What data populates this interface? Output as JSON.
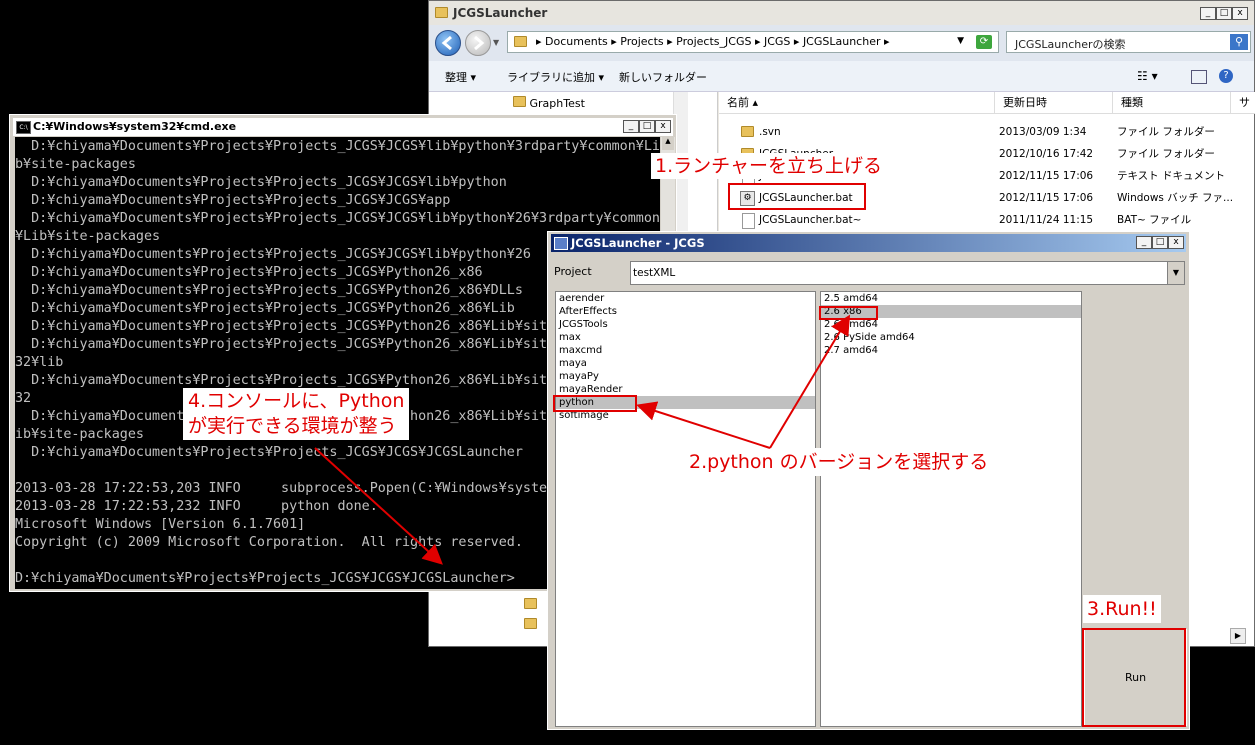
{
  "explorer": {
    "title": "JCGSLauncher",
    "breadcrumb": [
      "Documents",
      "Projects",
      "Projects_JCGS",
      "JCGS",
      "JCGSLauncher"
    ],
    "search_placeholder": "JCGSLauncherの検索",
    "toolbar": {
      "organize": "整理",
      "add_to_library": "ライブラリに追加",
      "new_folder": "新しいフォルダー"
    },
    "nav_item": "GraphTest",
    "columns": {
      "name": "名前",
      "modified": "更新日時",
      "type": "種類",
      "size": "サ"
    },
    "files": [
      {
        "name": ".svn",
        "modified": "2013/03/09 1:34",
        "type": "ファイル フォルダー"
      },
      {
        "name": "JCGSLauncher",
        "modified": "2012/10/16 17:42",
        "type": "ファイル フォルダー"
      },
      {
        "name": "JCGSLauncher.txt",
        "modified": "2012/11/15 17:06",
        "type": "テキスト ドキュメント"
      },
      {
        "name": "JCGSLauncher.bat",
        "modified": "2012/11/15 17:06",
        "type": "Windows バッチ ファ..."
      },
      {
        "name": "JCGSLauncher.bat~",
        "modified": "2011/11/24 11:15",
        "type": "BAT~ ファイル"
      }
    ]
  },
  "cmd": {
    "title": "C:¥Windows¥system32¥cmd.exe",
    "lines": [
      "  D:¥chiyama¥Documents¥Projects¥Projects_JCGS¥JCGS¥lib¥python¥3rdparty¥common¥Li",
      "b¥site-packages",
      "  D:¥chiyama¥Documents¥Projects¥Projects_JCGS¥JCGS¥lib¥python",
      "  D:¥chiyama¥Documents¥Projects¥Projects_JCGS¥JCGS¥app",
      "  D:¥chiyama¥Documents¥Projects¥Projects_JCGS¥JCGS¥lib¥python¥26¥3rdparty¥common",
      "¥Lib¥site-packages",
      "  D:¥chiyama¥Documents¥Projects¥Projects_JCGS¥JCGS¥lib¥python¥26",
      "  D:¥chiyama¥Documents¥Projects¥Projects_JCGS¥Python26_x86",
      "  D:¥chiyama¥Documents¥Projects¥Projects_JCGS¥Python26_x86¥DLLs",
      "  D:¥chiyama¥Documents¥Projects¥Projects_JCGS¥Python26_x86¥Lib",
      "  D:¥chiyama¥Documents¥Projects¥Projects_JCGS¥Python26_x86¥Lib¥site",
      "  D:¥chiyama¥Documents¥Projects¥Projects_JCGS¥Python26_x86¥Lib¥site",
      "32¥lib",
      "  D:¥chiyama¥Documents¥Projects¥Projects_JCGS¥Python26_x86¥Lib¥site",
      "32",
      "  D:¥chiyama¥Documents¥Projects¥Projects_JCGS¥Python26_x86¥Lib¥site-packages¥PySide+4.7.7_py26",
      "ib¥site-packages",
      "  D:¥chiyama¥Documents¥Projects¥Projects_JCGS¥JCGS¥JCGSLauncher",
      "",
      "2013-03-28 17:22:53,203 INFO     subprocess.Popen(C:¥Windows¥system32",
      "2013-03-28 17:22:53,232 INFO     python done.",
      "Microsoft Windows [Version 6.1.7601]",
      "Copyright (c) 2009 Microsoft Corporation.  All rights reserved.",
      "",
      "D:¥chiyama¥Documents¥Projects¥Projects_JCGS¥JCGS¥JCGSLauncher>"
    ]
  },
  "launcher": {
    "title": "JCGSLauncher - JCGS",
    "project_label": "Project",
    "project_value": "testXML",
    "apps": [
      "aerender",
      "AfterEffects",
      "JCGSTools",
      "max",
      "maxcmd",
      "maya",
      "mayaPy",
      "mayaRender",
      "python",
      "softimage"
    ],
    "selected_app": "python",
    "versions": [
      "2.5 amd64",
      "2.6 x86",
      "2.6 amd64",
      "2.6 PySide amd64",
      "2.7 amd64"
    ],
    "selected_version": "2.6 x86",
    "run_label": "Run"
  },
  "annotations": {
    "step1": "1.ランチャーを立ち上げる",
    "step2": "2.python のバージョンを選択する",
    "step3": "3.Run!!",
    "step4_line1": "4.コンソールに、Python",
    "step4_line2": "が実行できる環境が整う"
  },
  "colors": {
    "annotation_red": "#e00000",
    "console_text": "#c0c0c0",
    "launcher_titlebar": "#0a246a"
  }
}
